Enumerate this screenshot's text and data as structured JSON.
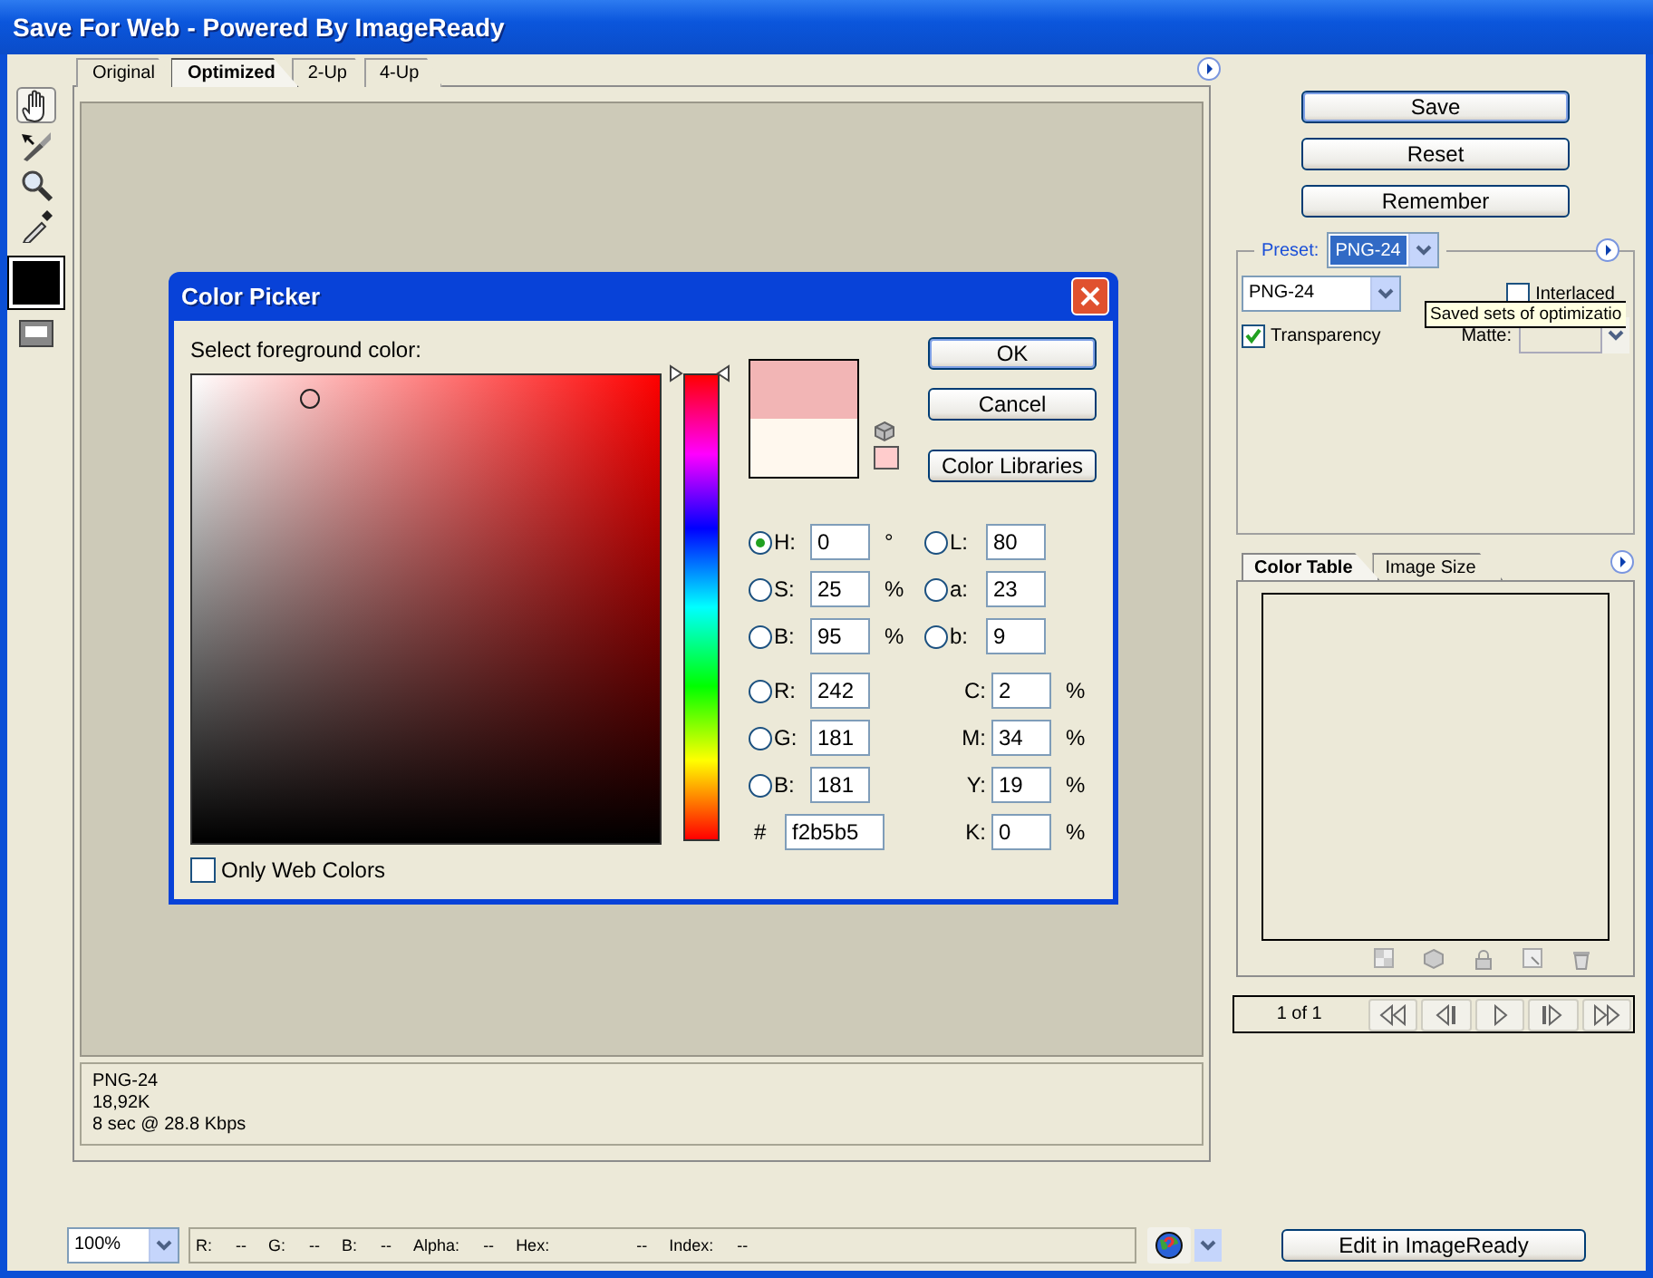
{
  "window": {
    "title": "Save For Web - Powered By ImageReady"
  },
  "tools": [
    {
      "kind": "hand",
      "selected": true
    },
    {
      "kind": "slice-select",
      "selected": false
    },
    {
      "kind": "zoom",
      "selected": false
    },
    {
      "kind": "eyedropper",
      "selected": false
    }
  ],
  "tabs": [
    {
      "label": "Original",
      "selected": false
    },
    {
      "label": "Optimized",
      "selected": true
    },
    {
      "label": "2-Up",
      "selected": false
    },
    {
      "label": "4-Up",
      "selected": false
    }
  ],
  "image_info": [
    "PNG-24",
    "18,92K",
    "8 sec @ 28.8 Kbps"
  ],
  "color_picker": {
    "title": "Color Picker",
    "prompt": "Select foreground color:",
    "buttons": [
      "OK",
      "Cancel",
      "Color Libraries"
    ],
    "hsb": [
      {
        "label": "H:",
        "value": "0",
        "unit": "°",
        "selected": true
      },
      {
        "label": "S:",
        "value": "25",
        "unit": "%",
        "selected": false
      },
      {
        "label": "B:",
        "value": "95",
        "unit": "%",
        "selected": false
      }
    ],
    "rgb": [
      {
        "label": "R:",
        "value": "242",
        "selected": false
      },
      {
        "label": "G:",
        "value": "181",
        "selected": false
      },
      {
        "label": "B:",
        "value": "181",
        "selected": false
      }
    ],
    "hex": {
      "label": "#",
      "value": "f2b5b5"
    },
    "lab": [
      {
        "label": "L:",
        "value": "80",
        "selected": false
      },
      {
        "label": "a:",
        "value": "23",
        "selected": false
      },
      {
        "label": "b:",
        "value": "9",
        "selected": false
      }
    ],
    "cmyk": [
      {
        "label": "C:",
        "value": "2",
        "unit": "%"
      },
      {
        "label": "M:",
        "value": "34",
        "unit": "%"
      },
      {
        "label": "Y:",
        "value": "19",
        "unit": "%"
      },
      {
        "label": "K:",
        "value": "0",
        "unit": "%"
      }
    ],
    "only_web_colors": {
      "label": "Only Web Colors",
      "checked": false
    },
    "hue_slider": {
      "level": 1
    }
  },
  "actions": [
    "Save",
    "Reset",
    "Remember"
  ],
  "preset": {
    "label": "Preset:",
    "value": "PNG-24",
    "format": "PNG-24",
    "interlaced": {
      "label": "Interlaced",
      "checked": false
    },
    "transparency": {
      "label": "Transparency",
      "checked": true
    },
    "matte": {
      "label": "Matte:"
    }
  },
  "tooltip": "Saved sets of optimizatio",
  "panel_tabs": [
    {
      "label": "Color Table",
      "selected": true
    },
    {
      "label": "Image Size",
      "selected": false
    }
  ],
  "pager": {
    "text": "1 of 1"
  },
  "status": {
    "zoom": "100%",
    "readouts": [
      {
        "label": "R:",
        "value": "--"
      },
      {
        "label": "G:",
        "value": "--"
      },
      {
        "label": "B:",
        "value": "--"
      },
      {
        "label": "Alpha:",
        "value": "--"
      },
      {
        "label": "Hex:",
        "value": "--"
      },
      {
        "label": "Index:",
        "value": "--"
      }
    ]
  },
  "edit_button": "Edit in ImageReady"
}
